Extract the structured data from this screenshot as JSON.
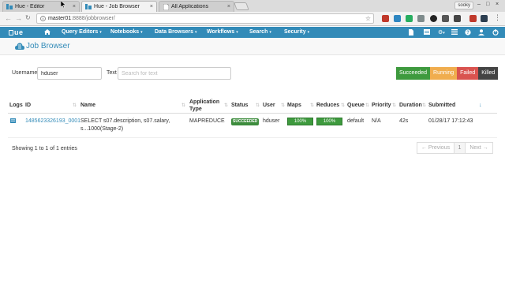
{
  "browser": {
    "tabs": [
      {
        "title": "Hue - Editor",
        "close": "×",
        "active": false
      },
      {
        "title": "Hue - Job Browser",
        "close": "×",
        "active": true
      },
      {
        "title": "All Applications",
        "close": "×",
        "active": false
      }
    ],
    "user": "sooky",
    "url_host": "master01",
    "url_path": ":8888/jobbrowser/",
    "window_controls": [
      "–",
      "□",
      "×"
    ]
  },
  "hue_nav": {
    "logo": "ue",
    "items": [
      "Query Editors",
      "Notebooks",
      "Data Browsers",
      "Workflows",
      "Search",
      "Security"
    ],
    "caret": "▾"
  },
  "header": {
    "title": "Job Browser"
  },
  "filters": {
    "username_label": "Username",
    "username_value": "hduser",
    "text_label": "Text",
    "text_placeholder": "Search for text",
    "status_buttons": [
      {
        "label": "Succeeded",
        "color": "#3e9a3e"
      },
      {
        "label": "Running",
        "color": "#f0ad4e"
      },
      {
        "label": "Failed",
        "color": "#d9534f"
      },
      {
        "label": "Killed",
        "color": "#444444"
      }
    ]
  },
  "table": {
    "headers": {
      "logs": "Logs",
      "id": "ID",
      "name": "Name",
      "app_type": "Application Type",
      "status": "Status",
      "user": "User",
      "maps": "Maps",
      "reduces": "Reduces",
      "queue": "Queue",
      "priority": "Priority",
      "duration": "Duration",
      "submitted": "Submitted"
    },
    "rows": [
      {
        "id": "1485623326193_0001",
        "name": "SELECT s07.description, s07.salary, s...1000(Stage-2)",
        "app_type": "MAPREDUCE",
        "status": "SUCCEEDED",
        "user": "hduser",
        "maps": "100%",
        "maps_progress": 1.0,
        "reduces": "100%",
        "reduces_progress": 1.0,
        "queue": "default",
        "priority": "N/A",
        "duration": "42s",
        "submitted": "01/28/17 17:12:43"
      }
    ],
    "info": "Showing 1 to 1 of 1 entries"
  },
  "pagination": {
    "previous": "← Previous",
    "page": "1",
    "next": "Next →"
  }
}
